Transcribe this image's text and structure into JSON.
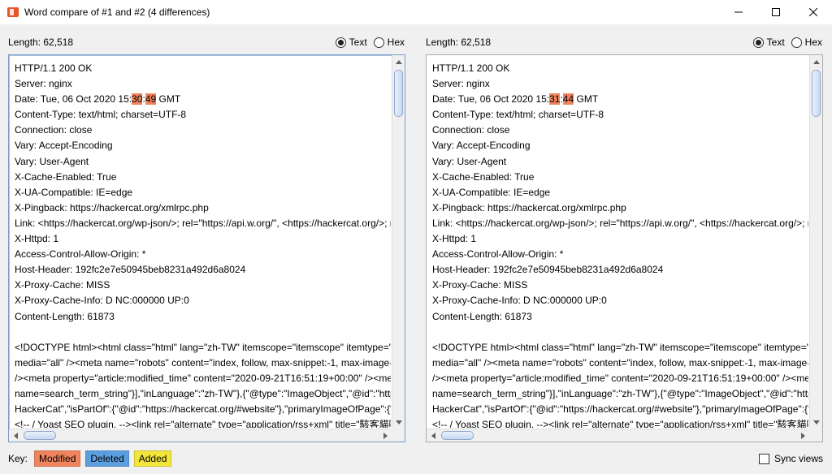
{
  "window": {
    "title": "Word compare of #1 and #2  (4 differences)",
    "accent_color": "#e8542b"
  },
  "panels": [
    {
      "length_label": "Length: 62,518",
      "radio_text": "Text",
      "radio_hex": "Hex",
      "selected": "Text",
      "lines": [
        [
          {
            "t": "HTTP/1.1 200 OK"
          }
        ],
        [
          {
            "t": "Server: nginx"
          }
        ],
        [
          {
            "t": "Date: Tue, 06 Oct 2020 15:"
          },
          {
            "t": "30",
            "d": "mod"
          },
          {
            "t": ":"
          },
          {
            "t": "49",
            "d": "mod"
          },
          {
            "t": " GMT"
          }
        ],
        [
          {
            "t": "Content-Type: text/html; charset=UTF-8"
          }
        ],
        [
          {
            "t": "Connection: close"
          }
        ],
        [
          {
            "t": "Vary: Accept-Encoding"
          }
        ],
        [
          {
            "t": "Vary: User-Agent"
          }
        ],
        [
          {
            "t": "X-Cache-Enabled: True"
          }
        ],
        [
          {
            "t": "X-UA-Compatible: IE=edge"
          }
        ],
        [
          {
            "t": "X-Pingback: https://hackercat.org/xmlrpc.php"
          }
        ],
        [
          {
            "t": "Link: <https://hackercat.org/wp-json/>; rel=\"https://api.w.org/\", <https://hackercat.org/>; rel=shortlink"
          }
        ],
        [
          {
            "t": "X-Httpd: 1"
          }
        ],
        [
          {
            "t": "Access-Control-Allow-Origin: *"
          }
        ],
        [
          {
            "t": "Host-Header: 192fc2e7e50945beb8231a492d6a8024"
          }
        ],
        [
          {
            "t": "X-Proxy-Cache: MISS"
          }
        ],
        [
          {
            "t": "X-Proxy-Cache-Info: D NC:000000 UP:0"
          }
        ],
        [
          {
            "t": "Content-Length: 61873"
          }
        ],
        [
          {
            "t": ""
          }
        ],
        [
          {
            "t": "<!DOCTYPE html><html class=\"html\" lang=\"zh-TW\" itemscope=\"itemscope\" itemtype=\"https://schema.org/WebPage\">"
          }
        ],
        [
          {
            "t": "media=\"all\" /><meta name=\"robots\" content=\"index, follow, max-snippet:-1, max-image-preview:large\" />"
          }
        ],
        [
          {
            "t": "/><meta property=\"article:modified_time\" content=\"2020-09-21T16:51:19+00:00\" /><meta property=\"og:image\" />"
          }
        ],
        [
          {
            "t": "name=search_term_string\"}],\"inLanguage\":\"zh-TW\"},{\"@type\":\"ImageObject\",\"@id\":\"https://hackercat.org/\"}"
          }
        ],
        [
          {
            "t": "HackerCat\",\"isPartOf\":{\"@id\":\"https://hackercat.org/#website\"},\"primaryImageOfPage\":{\"@id\":\"#\"}"
          }
        ],
        [
          {
            "t": "<!-- / Yoast SEO plugin. --><link rel=\"alternate\" type=\"application/rss+xml\" title=\"駭客貓咪\" />"
          }
        ]
      ]
    },
    {
      "length_label": "Length: 62,518",
      "radio_text": "Text",
      "radio_hex": "Hex",
      "selected": "Text",
      "lines": [
        [
          {
            "t": "HTTP/1.1 200 OK"
          }
        ],
        [
          {
            "t": "Server: nginx"
          }
        ],
        [
          {
            "t": "Date: Tue, 06 Oct 2020 15:"
          },
          {
            "t": "31",
            "d": "mod"
          },
          {
            "t": ":"
          },
          {
            "t": "44",
            "d": "mod"
          },
          {
            "t": " GMT"
          }
        ],
        [
          {
            "t": "Content-Type: text/html; charset=UTF-8"
          }
        ],
        [
          {
            "t": "Connection: close"
          }
        ],
        [
          {
            "t": "Vary: Accept-Encoding"
          }
        ],
        [
          {
            "t": "Vary: User-Agent"
          }
        ],
        [
          {
            "t": "X-Cache-Enabled: True"
          }
        ],
        [
          {
            "t": "X-UA-Compatible: IE=edge"
          }
        ],
        [
          {
            "t": "X-Pingback: https://hackercat.org/xmlrpc.php"
          }
        ],
        [
          {
            "t": "Link: <https://hackercat.org/wp-json/>; rel=\"https://api.w.org/\", <https://hackercat.org/>; rel=shortlink"
          }
        ],
        [
          {
            "t": "X-Httpd: 1"
          }
        ],
        [
          {
            "t": "Access-Control-Allow-Origin: *"
          }
        ],
        [
          {
            "t": "Host-Header: 192fc2e7e50945beb8231a492d6a8024"
          }
        ],
        [
          {
            "t": "X-Proxy-Cache: MISS"
          }
        ],
        [
          {
            "t": "X-Proxy-Cache-Info: D NC:000000 UP:0"
          }
        ],
        [
          {
            "t": "Content-Length: 61873"
          }
        ],
        [
          {
            "t": ""
          }
        ],
        [
          {
            "t": "<!DOCTYPE html><html class=\"html\" lang=\"zh-TW\" itemscope=\"itemscope\" itemtype=\"https://schema.org/WebPage\">"
          }
        ],
        [
          {
            "t": "media=\"all\" /><meta name=\"robots\" content=\"index, follow, max-snippet:-1, max-image-preview:large\" />"
          }
        ],
        [
          {
            "t": "/><meta property=\"article:modified_time\" content=\"2020-09-21T16:51:19+00:00\" /><meta property=\"og:image\" />"
          }
        ],
        [
          {
            "t": "name=search_term_string\"}],\"inLanguage\":\"zh-TW\"},{\"@type\":\"ImageObject\",\"@id\":\"https://hackercat.org/\"}"
          }
        ],
        [
          {
            "t": "HackerCat\",\"isPartOf\":{\"@id\":\"https://hackercat.org/#website\"},\"primaryImageOfPage\":{\"@id\":\"#\"}"
          }
        ],
        [
          {
            "t": "<!-- / Yoast SEO plugin. --><link rel=\"alternate\" type=\"application/rss+xml\" title=\"駭客貓咪\" />"
          }
        ]
      ]
    }
  ],
  "footer": {
    "key_label": "Key:",
    "keys": [
      {
        "label": "Modified",
        "color": "#f0845e"
      },
      {
        "label": "Deleted",
        "color": "#5c9fe0"
      },
      {
        "label": "Added",
        "color": "#f2e63a"
      }
    ],
    "sync_label": "Sync views",
    "sync_checked": false
  }
}
